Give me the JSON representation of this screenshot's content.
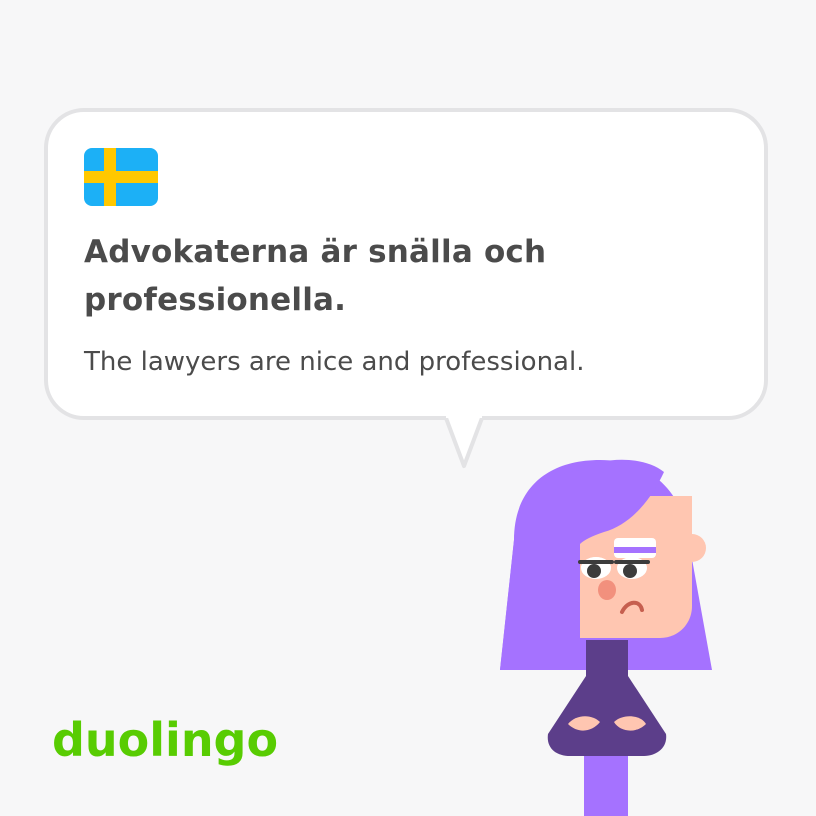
{
  "card": {
    "sentence_swedish": "Advokaterna är snälla och professionella.",
    "translation_english": "The lawyers are nice and professional.",
    "language_flag_icon": "sweden-flag-icon",
    "character_icon": "lily-character-illustration",
    "brand_logo": "duolingo"
  },
  "colors": {
    "background": "#f7f7f8",
    "bubble_fill": "#ffffff",
    "bubble_border": "#e3e3e5",
    "text": "#4b4b4b",
    "brand_green": "#58cc02",
    "flag_blue": "#1cb0f6",
    "flag_yellow": "#ffc800",
    "hair_purple": "#a572ff",
    "shirt_purple": "#5c3e8a",
    "skin": "#ffc6b1"
  }
}
